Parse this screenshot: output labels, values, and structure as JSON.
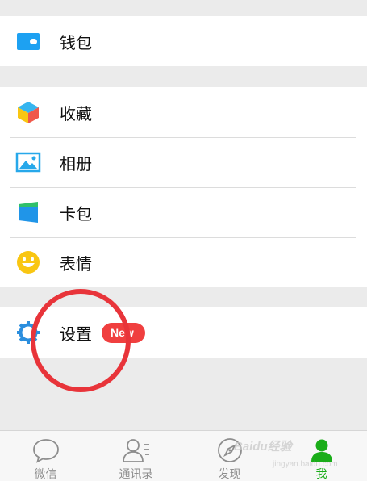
{
  "menu": {
    "wallet": {
      "label": "钱包",
      "icon": "wallet-icon",
      "color": "#1da1f2"
    },
    "favorites": {
      "label": "收藏",
      "icon": "cube-icon"
    },
    "album": {
      "label": "相册",
      "icon": "picture-icon",
      "color": "#27a8ea"
    },
    "cards": {
      "label": "卡包",
      "icon": "card-icon"
    },
    "stickers": {
      "label": "表情",
      "icon": "smiley-icon",
      "color": "#f9c612"
    },
    "settings": {
      "label": "设置",
      "icon": "gear-icon",
      "color": "#2b8ede",
      "badge": "New"
    }
  },
  "tabbar": {
    "tabs": [
      {
        "label": "微信",
        "icon": "chat-bubble-icon",
        "active": false
      },
      {
        "label": "通讯录",
        "icon": "contacts-icon",
        "active": false
      },
      {
        "label": "发现",
        "icon": "compass-icon",
        "active": false
      },
      {
        "label": "我",
        "icon": "person-icon",
        "active": true
      }
    ],
    "active_color": "#1aad19",
    "inactive_color": "#8e8e8e"
  },
  "overlay": {
    "annotation": "red-circle-highlight-settings",
    "annotation_color": "#e8343a",
    "watermark": "Baidu经验",
    "watermark_sub": "jingyan.baidu.com"
  }
}
